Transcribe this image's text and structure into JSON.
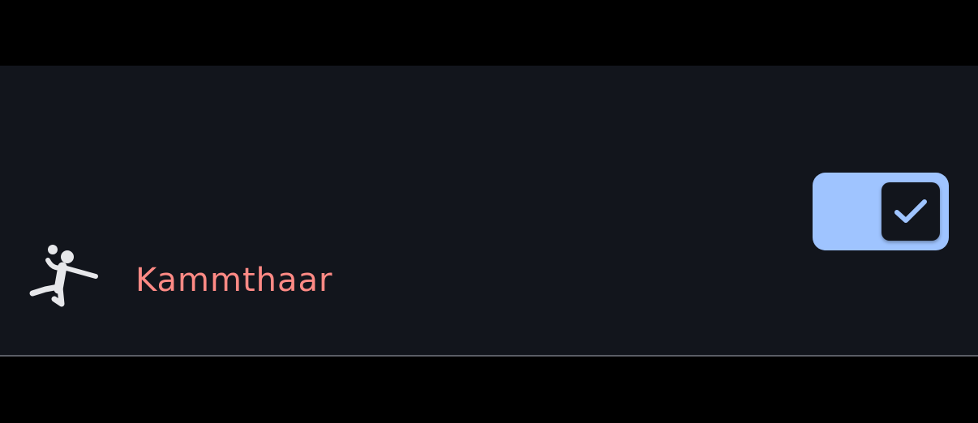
{
  "row": {
    "label": "Kammthaar",
    "icon": "handball-player-icon",
    "toggle": {
      "checked": true,
      "thumb_icon": "check-icon"
    }
  },
  "colors": {
    "background": "#000000",
    "row_surface": "#12151c",
    "label": "#ff8a85",
    "icon": "#e6e7ea",
    "toggle_track": "#9fc4ff",
    "toggle_thumb": "#12151c",
    "check": "#9fc4ff",
    "divider": "#5b5e66"
  }
}
